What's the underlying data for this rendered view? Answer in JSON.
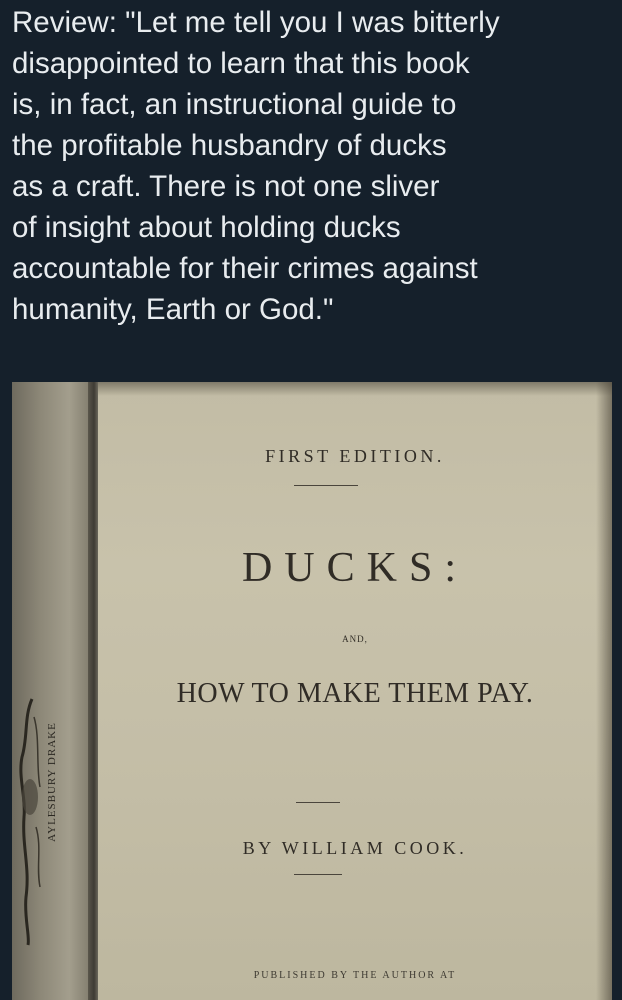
{
  "review": {
    "text": "Review: \"Let me tell you I was bitterly\ndisappointed to learn that this book\nis, in fact, an instructional guide to\nthe profitable husbandry of ducks\nas a craft. There is not one sliver\nof insight about holding ducks\naccountable for their crimes against\nhumanity, Earth or God.\""
  },
  "book": {
    "edition": "FIRST EDITION.",
    "title": "DUCKS:",
    "and": "AND,",
    "subtitle": "HOW TO MAKE THEM PAY.",
    "author": "BY WILLIAM COOK.",
    "publisher": "PUBLISHED BY THE AUTHOR AT",
    "spine_caption": "AYLESBURY DRAKE"
  },
  "colors": {
    "background": "#15202b",
    "text": "#e8ecef",
    "paper": "#c4bea7",
    "ink": "#302c26"
  }
}
